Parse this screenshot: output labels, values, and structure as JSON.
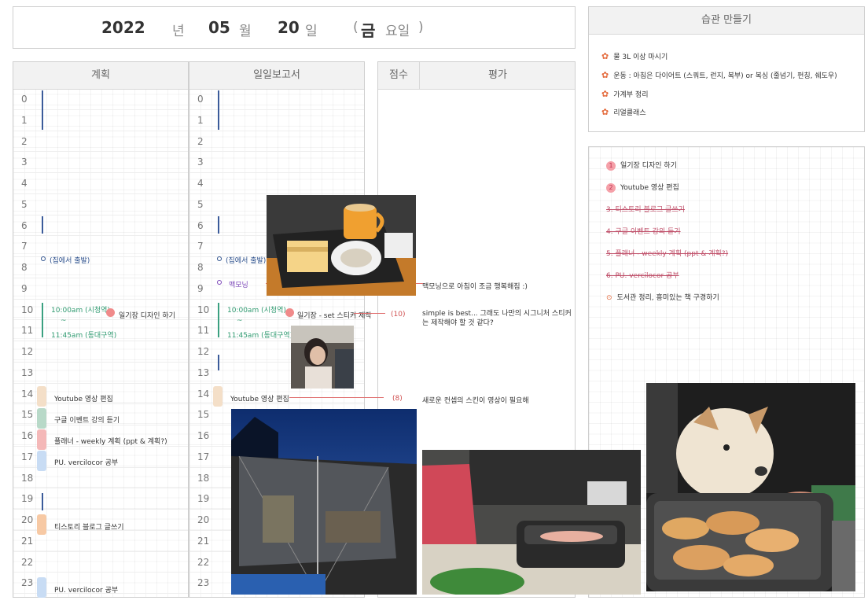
{
  "date": {
    "year": "2022",
    "year_unit": "년",
    "month": "05",
    "month_unit": "월",
    "day": "20",
    "day_unit": "일",
    "weekday_open": "(",
    "weekday": "금",
    "weekday_unit": "요일",
    "weekday_close": ")"
  },
  "columns": {
    "plan": "계획",
    "report": "일일보고서",
    "score": "점수",
    "eval": "평가"
  },
  "hours": [
    "0",
    "1",
    "2",
    "3",
    "4",
    "5",
    "6",
    "7",
    "8",
    "9",
    "10",
    "11",
    "12",
    "13",
    "14",
    "15",
    "16",
    "17",
    "18",
    "19",
    "20",
    "21",
    "22",
    "23"
  ],
  "plan_notes": {
    "leave_home": "(집에서 출발)",
    "time_range_start": "10:00am (시청역)",
    "time_range_tilde": "~",
    "time_range_end": "11:45am (동대구역)",
    "design_diary": "일기장 디자인 하기",
    "youtube_edit": "Youtube 영상 편집",
    "google_event": "구글 이벤트 강의 듣기",
    "planner_weekly": "플래너 - weekly 계획 (ppt & 계획?)",
    "pu_study": "PU. vercilocor 공부",
    "tistory_blog": "티스토리 블로그 글쓰기",
    "pu_study_2": "PU. vercilocor 공부"
  },
  "report_notes": {
    "leave_home": "(집에서 출발)",
    "breakfast": "맥모닝",
    "time_range_start": "10:00am (시청역)",
    "time_range_tilde": "~",
    "time_range_end": "11:45am (동대구역)",
    "diary_set": "일기장 - set 스티커 제작",
    "youtube_edit": "Youtube 영상 편집"
  },
  "scores": {
    "s10": "(10)",
    "s14": "(8)"
  },
  "evals": {
    "e9": "맥모닝으로 아침이 조금 행복해짐 :)",
    "e10": "simple is best... 그래도 나만의 시그니처 스티커는 제작해야 할 것 같다?",
    "e14": "새로운 컨셉의 스킨이 영상이 필요해"
  },
  "habit": {
    "title": "습관 만들기",
    "items": [
      "물 3L 이상 마시기",
      "운동 : 아침은 다이어트 (스쿼트, 런지, 복부) or 복싱 (줄넘기, 펀칭, 쉐도우)",
      "가계부 정리",
      "리얼클래스"
    ]
  },
  "todo": {
    "items": [
      {
        "num": "1",
        "text": "일기장 디자인 하기"
      },
      {
        "num": "2",
        "text": "Youtube 영상 편집"
      },
      {
        "num": "3.",
        "text": "티스토리 블로그 글쓰기"
      },
      {
        "num": "4.",
        "text": "구글 이벤트 강의 듣기"
      },
      {
        "num": "5.",
        "text": "플래너 - weekly 계획 (ppt & 계획?)"
      },
      {
        "num": "6.",
        "text": "PU. vercilocor 공부"
      },
      {
        "num": "⊙",
        "text": "도서관 정리, 흥미있는 책 구경하기"
      }
    ]
  },
  "colors": {
    "blue_ink": "#2b4f8c",
    "green_ink": "#3aa080",
    "pink_highlight": "#f08a8a",
    "header_bg": "#f2f2f2"
  }
}
